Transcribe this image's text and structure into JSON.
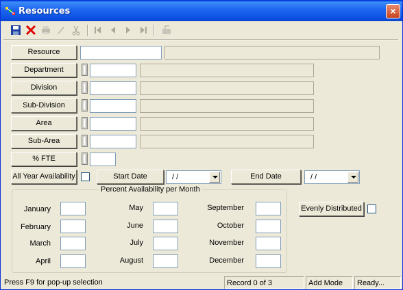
{
  "window": {
    "title": "Resources",
    "close": "×"
  },
  "toolbar": {
    "icons": [
      "save-icon",
      "delete-icon",
      "print-icon",
      "edit-icon",
      "cut-icon",
      "first-record-icon",
      "previous-record-icon",
      "next-record-icon",
      "last-record-icon",
      "export-icon"
    ]
  },
  "form": {
    "resource_label": "Resource",
    "department_label": "Department",
    "division_label": "Division",
    "subdivision_label": "Sub-Division",
    "area_label": "Area",
    "subarea_label": "Sub-Area",
    "fte_label": "% FTE",
    "all_year_label": "All Year Availability",
    "start_date_label": "Start Date",
    "start_date_value": "/ /",
    "end_date_label": "End Date",
    "end_date_value": "/ /"
  },
  "availability": {
    "group_title": "Percent Availability per Month",
    "months": [
      "January",
      "February",
      "March",
      "April",
      "May",
      "June",
      "July",
      "August",
      "September",
      "October",
      "November",
      "December"
    ],
    "evenly_label": "Evenly Distributed"
  },
  "status": {
    "hint": "Press F9 for pop-up selection",
    "record": "Record 0 of 3",
    "mode": "Add Mode",
    "state": "Ready..."
  },
  "colors": {
    "titlebar": "#0A4FE0",
    "face": "#ECE9D8",
    "input_border": "#7F9DB9"
  }
}
